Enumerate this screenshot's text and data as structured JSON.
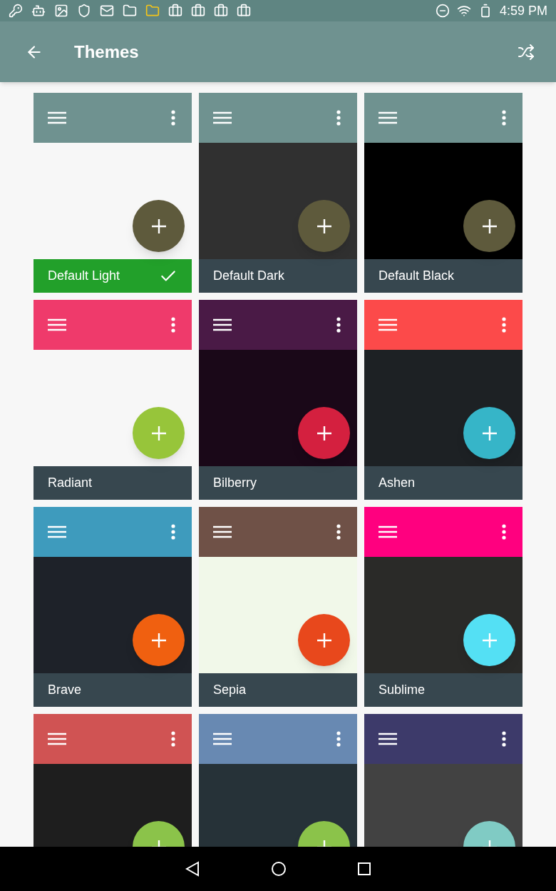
{
  "status_bar": {
    "time": "4:59 PM"
  },
  "app_bar": {
    "title": "Themes"
  },
  "themes": [
    {
      "name": "Default Light",
      "selected": true,
      "header": {
        "color": "#6f9290"
      },
      "body": {
        "color": "#f7f7f7"
      },
      "accent": {
        "color": "#5e5a3c"
      }
    },
    {
      "name": "Default Dark",
      "selected": false,
      "header": {
        "color": "#6f9290"
      },
      "body": {
        "color": "#303030"
      },
      "accent": {
        "color": "#5e5a3c"
      }
    },
    {
      "name": "Default Black",
      "selected": false,
      "header": {
        "color": "#6f9290"
      },
      "body": {
        "color": "#000000"
      },
      "accent": {
        "color": "#5e5a3c"
      }
    },
    {
      "name": "Radiant",
      "selected": false,
      "header": {
        "color": "#ef3a6b"
      },
      "body": {
        "color": "#f7f7f7"
      },
      "accent": {
        "color": "#97c53a"
      }
    },
    {
      "name": "Bilberry",
      "selected": false,
      "header": {
        "color": "#4a1a46"
      },
      "body": {
        "color": "#1a0818"
      },
      "accent": {
        "color": "#d4203f"
      }
    },
    {
      "name": "Ashen",
      "selected": false,
      "header": {
        "color": "#fc4a4a"
      },
      "body": {
        "color": "#1d2124"
      },
      "accent": {
        "color": "#36b5c8"
      }
    },
    {
      "name": "Brave",
      "selected": false,
      "header": {
        "color": "#3e9bbd"
      },
      "body": {
        "color": "#1e2229"
      },
      "accent": {
        "color": "#f06010"
      }
    },
    {
      "name": "Sepia",
      "selected": false,
      "header": {
        "color": "#6f5147"
      },
      "body": {
        "color": "#f1f8e9"
      },
      "accent": {
        "color": "#e8481c"
      }
    },
    {
      "name": "Sublime",
      "selected": false,
      "header": {
        "color": "#ff007f"
      },
      "body": {
        "color": "#2a2a28"
      },
      "accent": {
        "color": "#54e0f4"
      }
    },
    {
      "header": {
        "color": "#d05353"
      },
      "body": {
        "color": "#1e1e1e"
      },
      "accent": {
        "color": "#8bc34a"
      }
    },
    {
      "header": {
        "color": "#6889b2"
      },
      "body": {
        "color": "#263238"
      },
      "accent": {
        "color": "#8bc34a"
      }
    },
    {
      "header": {
        "color": "#3d3a6a"
      },
      "body": {
        "color": "#424242"
      },
      "accent": {
        "color": "#80cbc4"
      }
    }
  ]
}
